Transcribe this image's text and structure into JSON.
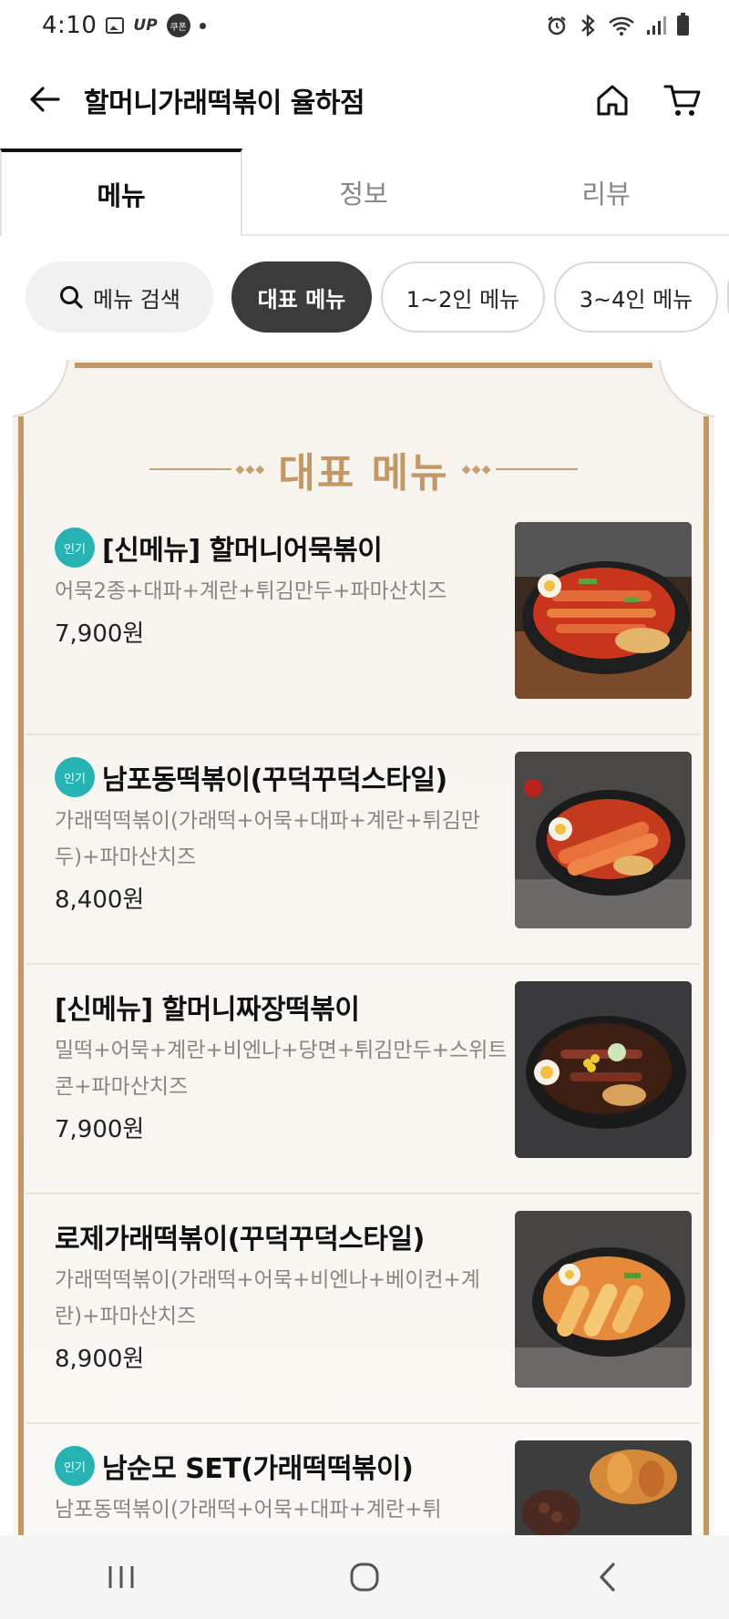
{
  "status_bar": {
    "time": "4:10",
    "up_label": "UP",
    "coupon_label": "쿠폰"
  },
  "header": {
    "title": "할머니가래떡볶이 율하점"
  },
  "tabs": [
    {
      "label": "메뉴",
      "active": true
    },
    {
      "label": "정보",
      "active": false
    },
    {
      "label": "리뷰",
      "active": false
    }
  ],
  "chips": {
    "search_label": "메뉴 검색",
    "items": [
      {
        "label": "대표 메뉴",
        "active": true
      },
      {
        "label": "1~2인 메뉴",
        "active": false
      },
      {
        "label": "3~4인 메뉴",
        "active": false
      }
    ]
  },
  "section": {
    "title": "대표 메뉴"
  },
  "menu_items": [
    {
      "badge": "인기",
      "name": "[신메뉴] 할머니어묵볶이",
      "desc": "어묵2종+대파+계란+튀김만두+파마산치즈",
      "price": "7,900원"
    },
    {
      "badge": "인기",
      "name": "남포동떡볶이(꾸덕꾸덕스타일)",
      "desc": "가래떡떡볶이(가래떡+어묵+대파+계란+튀김만두)+파마산치즈",
      "price": "8,400원"
    },
    {
      "badge": "",
      "name": "[신메뉴] 할머니짜장떡볶이",
      "desc": "밀떡+어묵+계란+비엔나+당면+튀김만두+스위트콘+파마산치즈",
      "price": "7,900원"
    },
    {
      "badge": "",
      "name": "로제가래떡볶이(꾸덕꾸덕스타일)",
      "desc": "가래떡떡볶이(가래떡+어묵+비엔나+베이컨+계란)+파마산치즈",
      "price": "8,900원"
    },
    {
      "badge": "인기",
      "name": "남순모 SET(가래떡떡볶이)",
      "desc": "남포동떡볶이(가래떡+어묵+대파+계란+튀",
      "price": ""
    }
  ],
  "colors": {
    "accent_gold": "#c39866",
    "badge_teal": "#27b3b3",
    "chip_active": "#3b3b3b"
  }
}
